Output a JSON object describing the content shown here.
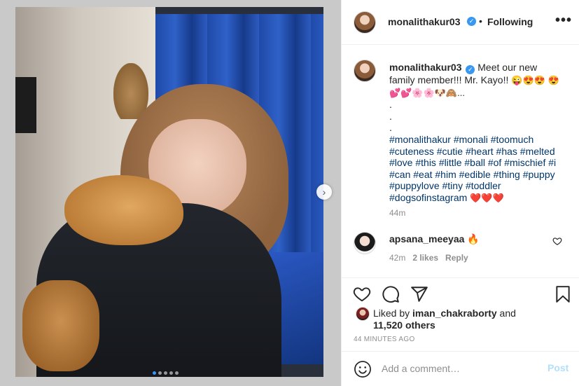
{
  "post": {
    "photo_description_icon": "photo-image",
    "carousel": {
      "total": 5,
      "active_index": 0
    }
  },
  "header": {
    "username": "monalithakur03",
    "separator": "•",
    "follow_status": "Following",
    "more_label": "•••"
  },
  "caption": {
    "username": "monalithakur03",
    "text": "Meet our new family member!!! Mr. Kayo!!",
    "emojis_line1": "😜😍😍",
    "emojis_line2": "😍💕💕🌸🌸🐶🙈...",
    "dots": [
      ".",
      ".",
      "."
    ],
    "hashtags": "#monalithakur #monali #toomuch #cuteness #cutie #heart #has #melted #love #this #little #ball #of #mischief #i #can #eat #him #edible #thing #puppy #puppylove #tiny #toddler #dogsofinstagram",
    "trailing_emojis": "❤️❤️❤️",
    "time": "44m"
  },
  "comment": {
    "username": "apsana_meeyaa",
    "emoji": "🔥",
    "time": "42m",
    "likes": "2 likes",
    "reply": "Reply"
  },
  "likes": {
    "prefix": "Liked by ",
    "user": "iman_chakraborty",
    "middle": " and",
    "others": "11,520 others"
  },
  "posted_time": "44 MINUTES AGO",
  "add_comment": {
    "placeholder": "Add a comment…",
    "post_label": "Post"
  },
  "colors": {
    "link_blue": "#003569",
    "verified_blue": "#3897f0",
    "post_disabled": "#b2dffc",
    "muted": "#8e8e8e",
    "heart_red": "#ed4956"
  }
}
